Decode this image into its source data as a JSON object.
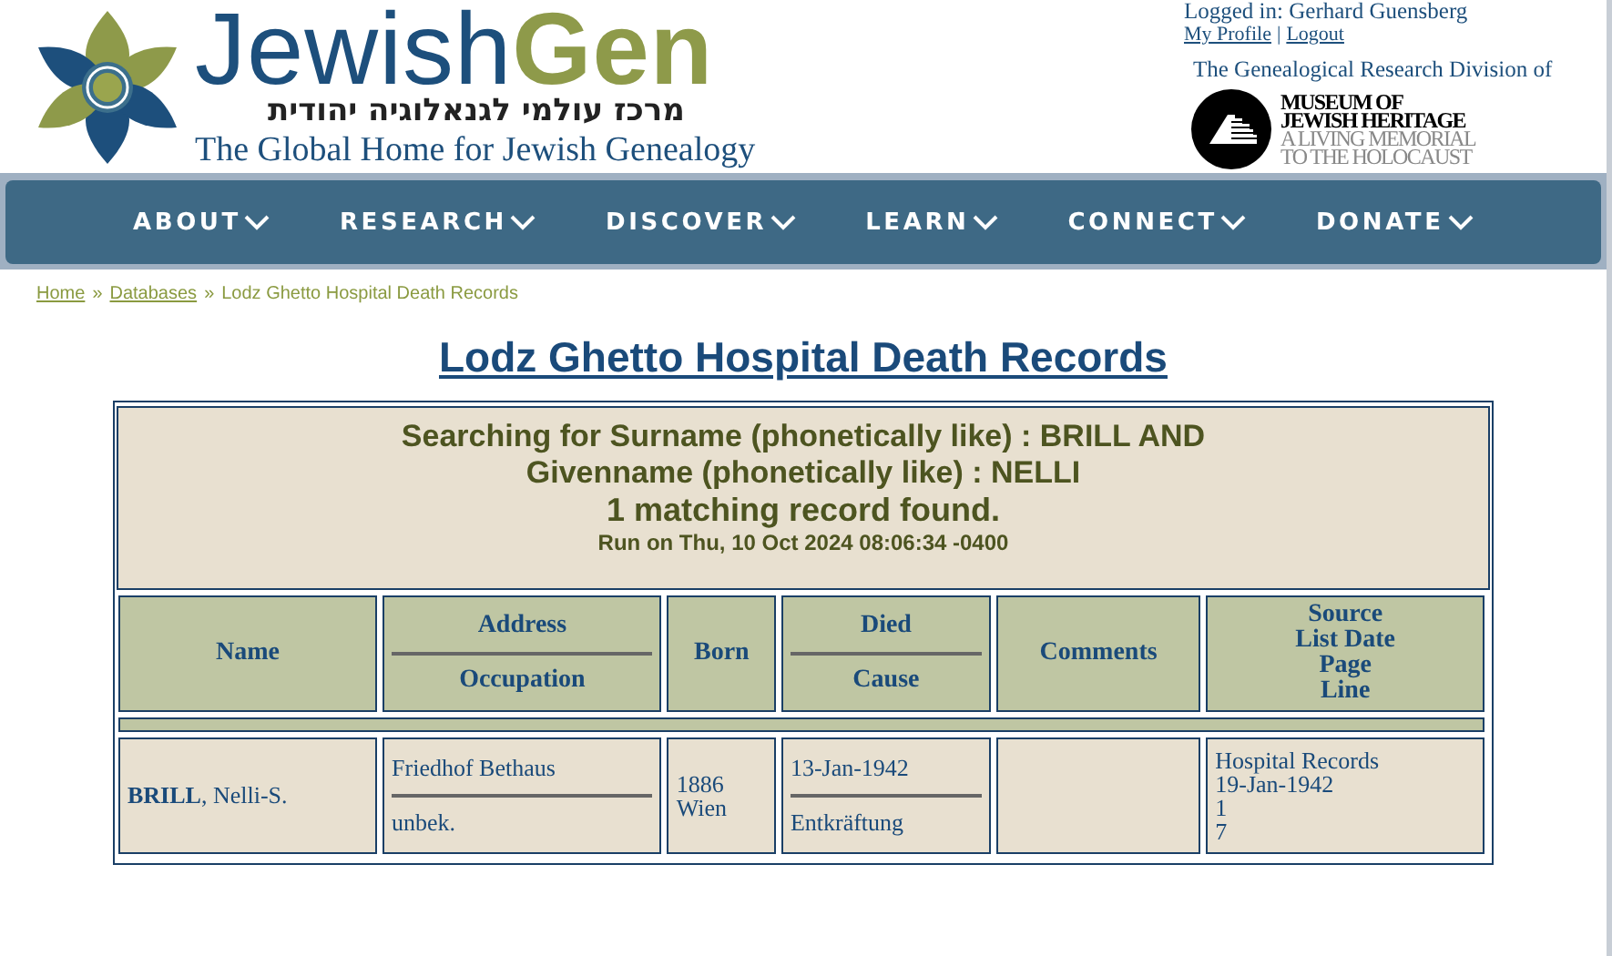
{
  "header": {
    "wordmark": [
      "Jewish",
      "Gen"
    ],
    "hebrew_tagline": "מרכז עולמי לגנאלוגיה יהודית",
    "tagline": "The Global Home for Jewish Genealogy"
  },
  "user": {
    "logged_in": "Logged in: Gerhard Guensberg",
    "links": [
      "My Profile",
      "Logout"
    ],
    "separator": "|"
  },
  "division": "The Genealogical Research Division of",
  "museum_logo": {
    "name_lines": [
      "MUSEUM OF",
      "JEWISH HERITAGE"
    ],
    "motto_lines": [
      "A LIVING MEMORIAL",
      "TO THE HOLOCAUST"
    ]
  },
  "nav": [
    {
      "label": "ABOUT"
    },
    {
      "label": "RESEARCH"
    },
    {
      "label": "DISCOVER"
    },
    {
      "label": "LEARN"
    },
    {
      "label": "CONNECT"
    },
    {
      "label": "DONATE"
    }
  ],
  "breadcrumb": {
    "links": [
      "Home",
      "Databases"
    ],
    "separator": "»",
    "current": "Lodz Ghetto Hospital Death Records"
  },
  "page_title": "Lodz Ghetto Hospital Death Records",
  "summary": {
    "query_lines": [
      "Searching for Surname (phonetically like) : BRILL AND",
      "Givenname (phonetically like) : NELLI"
    ],
    "result": "1 matching record found.",
    "run_on": "Run on Thu, 10 Oct 2024 08:06:34 -0400"
  },
  "table": {
    "columns": [
      {
        "kind": "single",
        "lines": [
          "Name"
        ]
      },
      {
        "kind": "split",
        "lines": [
          "Address",
          "Occupation"
        ]
      },
      {
        "kind": "single",
        "lines": [
          "Born"
        ]
      },
      {
        "kind": "split",
        "lines": [
          "Died",
          "Cause"
        ]
      },
      {
        "kind": "single",
        "lines": [
          "Comments"
        ]
      },
      {
        "kind": "stacked",
        "lines": [
          "Source",
          "List Date",
          "Page",
          "Line"
        ]
      }
    ],
    "rows": [
      [
        {
          "kind": "single",
          "lines": [
            "**BRILL**, Nelli-S."
          ]
        },
        {
          "kind": "split",
          "lines": [
            "Friedhof Bethaus",
            "unbek."
          ]
        },
        {
          "kind": "stacked",
          "lines": [
            "1886",
            "Wien"
          ]
        },
        {
          "kind": "split",
          "lines": [
            "13-Jan-1942",
            "Entkräftung"
          ]
        },
        {
          "kind": "empty"
        },
        {
          "kind": "stacked",
          "lines": [
            "Hospital Records",
            "19-Jan-1942",
            "1",
            "7"
          ]
        }
      ]
    ]
  }
}
